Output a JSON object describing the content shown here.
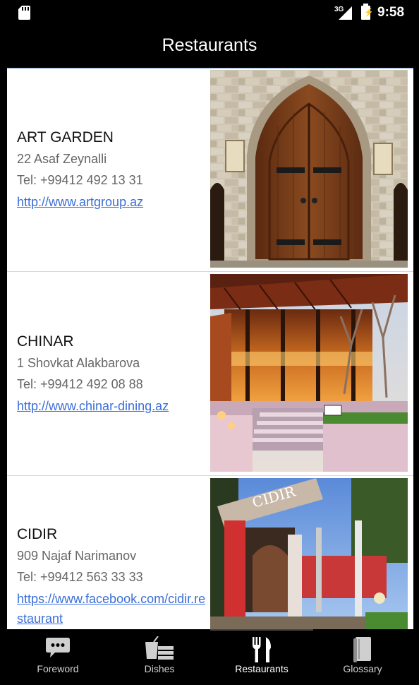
{
  "status_bar": {
    "network": "3G",
    "time": "9:58"
  },
  "app_bar": {
    "title": "Restaurants"
  },
  "restaurants": [
    {
      "name": "ART GARDEN",
      "address": "22 Asaf Zeynalli",
      "phone": "Tel: +99412 492 13 31",
      "url": "http://www.artgroup.az",
      "image": "arched-wooden-door"
    },
    {
      "name": "CHINAR",
      "address": "1 Shovkat Alakbarova",
      "phone": "Tel: +99412 492 08 88",
      "url": "http://www.chinar-dining.az",
      "image": "restaurant-terrace-night"
    },
    {
      "name": "CIDIR",
      "address": "909 Najaf Narimanov",
      "phone": "Tel: +99412 563 33 33",
      "url": "https://www.facebook.com/cidir.restaurant",
      "image": "cidir-entrance-archway"
    }
  ],
  "bottom_nav": {
    "items": [
      {
        "label": "Foreword",
        "icon": "speech-bubble-icon"
      },
      {
        "label": "Dishes",
        "icon": "dishes-icon"
      },
      {
        "label": "Restaurants",
        "icon": "fork-knife-icon"
      },
      {
        "label": "Glossary",
        "icon": "book-icon"
      }
    ],
    "active": "Restaurants"
  },
  "colors": {
    "link": "#3b6fd8",
    "background": "#000000",
    "card": "#ffffff"
  }
}
